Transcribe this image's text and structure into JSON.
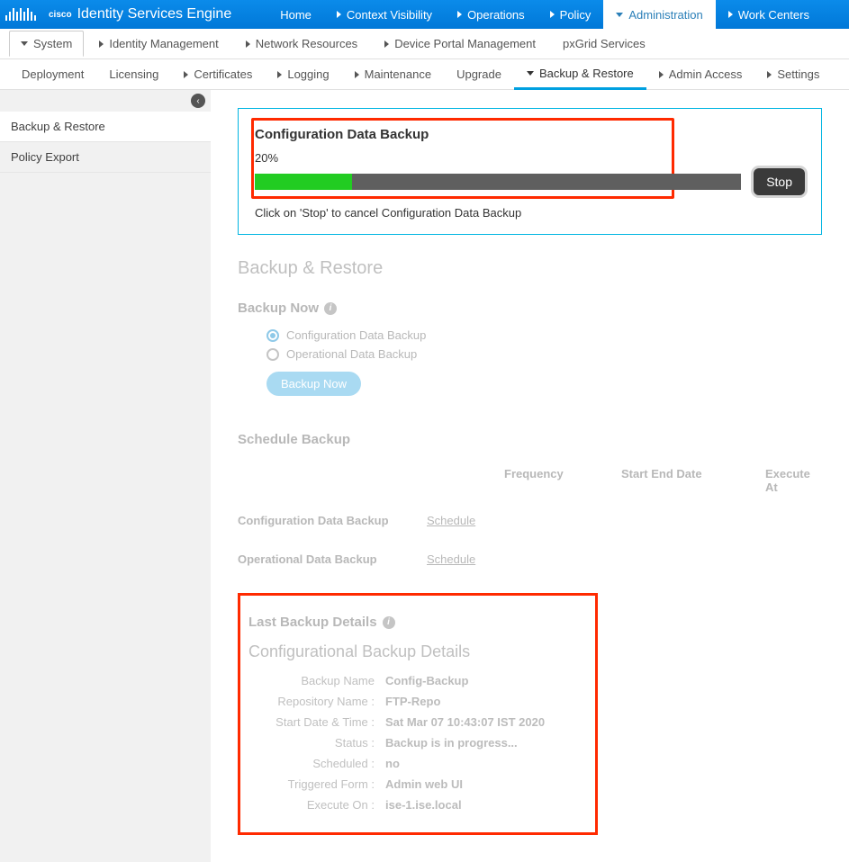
{
  "header": {
    "logo_text": "cisco",
    "product_name": "Identity Services Engine",
    "tabs": [
      {
        "label": "Home",
        "type": "none"
      },
      {
        "label": "Context Visibility",
        "type": "right"
      },
      {
        "label": "Operations",
        "type": "right"
      },
      {
        "label": "Policy",
        "type": "right"
      },
      {
        "label": "Administration",
        "type": "down",
        "active": true
      },
      {
        "label": "Work Centers",
        "type": "right"
      }
    ]
  },
  "second_row": [
    {
      "label": "System",
      "type": "down",
      "active": true
    },
    {
      "label": "Identity Management",
      "type": "right"
    },
    {
      "label": "Network Resources",
      "type": "right"
    },
    {
      "label": "Device Portal Management",
      "type": "right"
    },
    {
      "label": "pxGrid Services",
      "type": "none"
    }
  ],
  "third_row": [
    {
      "label": "Deployment",
      "type": "none"
    },
    {
      "label": "Licensing",
      "type": "none"
    },
    {
      "label": "Certificates",
      "type": "right"
    },
    {
      "label": "Logging",
      "type": "right"
    },
    {
      "label": "Maintenance",
      "type": "right"
    },
    {
      "label": "Upgrade",
      "type": "none"
    },
    {
      "label": "Backup & Restore",
      "type": "down",
      "active": true
    },
    {
      "label": "Admin Access",
      "type": "right"
    },
    {
      "label": "Settings",
      "type": "right"
    }
  ],
  "sidebar": {
    "items": [
      {
        "label": "Backup & Restore",
        "active": true
      },
      {
        "label": "Policy Export"
      }
    ]
  },
  "progress": {
    "title": "Configuration Data Backup",
    "percent_text": "20%",
    "percent_value": 20,
    "stop_label": "Stop",
    "hint": "Click on 'Stop' to cancel Configuration Data Backup"
  },
  "page_title": "Backup & Restore",
  "backup_now": {
    "heading": "Backup Now",
    "options": {
      "config": "Configuration Data Backup",
      "operational": "Operational Data Backup"
    },
    "button_label": "Backup Now"
  },
  "schedule": {
    "heading": "Schedule Backup",
    "headers": {
      "frequency": "Frequency",
      "start_end": "Start End Date",
      "execute_at": "Execute At"
    },
    "rows": {
      "config": "Configuration Data Backup",
      "operational": "Operational Data Backup"
    },
    "schedule_link": "Schedule"
  },
  "last_backup": {
    "heading": "Last Backup Details",
    "subheading": "Configurational Backup Details",
    "details": {
      "backup_name": {
        "label": "Backup Name",
        "value": "Config-Backup"
      },
      "repo": {
        "label": "Repository Name :",
        "value": "FTP-Repo"
      },
      "start": {
        "label": "Start Date & Time :",
        "value": "Sat Mar 07 10:43:07 IST 2020"
      },
      "status": {
        "label": "Status :",
        "value": "Backup is in progress..."
      },
      "scheduled": {
        "label": "Scheduled :",
        "value": "no"
      },
      "triggered": {
        "label": "Triggered Form :",
        "value": "Admin web UI"
      },
      "execute_on": {
        "label": "Execute On :",
        "value": "ise-1.ise.local"
      }
    }
  }
}
